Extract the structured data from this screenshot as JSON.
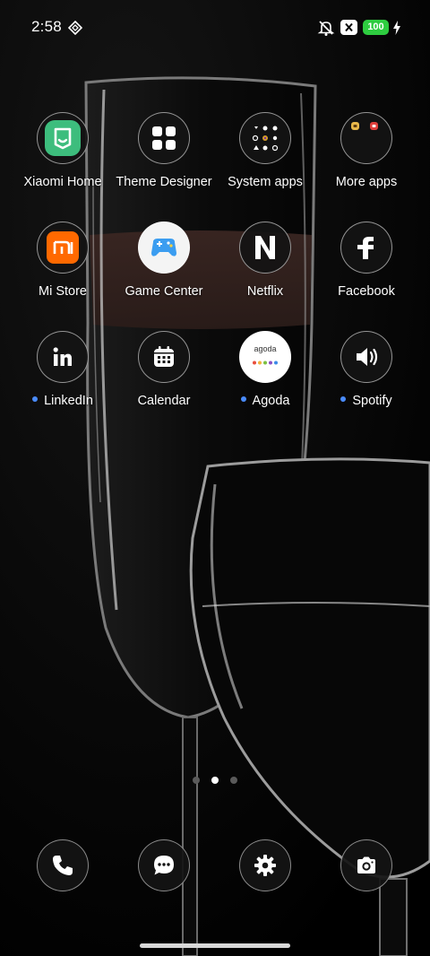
{
  "status_bar": {
    "time": "2:58",
    "battery_level": "100",
    "battery_color": "#2ecc40",
    "icons": [
      "nfc-icon",
      "silent-mode-icon",
      "close-box-icon",
      "battery-icon",
      "charging-bolt-icon"
    ]
  },
  "apps": [
    {
      "label": "Xiaomi Home",
      "icon": "xiaomi-home-icon",
      "new_badge": false
    },
    {
      "label": "Theme Designer",
      "icon": "theme-designer-icon",
      "new_badge": false
    },
    {
      "label": "System apps",
      "icon": "system-apps-folder-icon",
      "new_badge": false
    },
    {
      "label": "More apps",
      "icon": "more-apps-folder-icon",
      "new_badge": false
    },
    {
      "label": "Mi Store",
      "icon": "mi-store-icon",
      "new_badge": false
    },
    {
      "label": "Game Center",
      "icon": "game-center-icon",
      "new_badge": false
    },
    {
      "label": "Netflix",
      "icon": "netflix-icon",
      "new_badge": false
    },
    {
      "label": "Facebook",
      "icon": "facebook-icon",
      "new_badge": false
    },
    {
      "label": "LinkedIn",
      "icon": "linkedin-icon",
      "new_badge": true
    },
    {
      "label": "Calendar",
      "icon": "calendar-icon",
      "new_badge": false
    },
    {
      "label": "Agoda",
      "icon": "agoda-icon",
      "new_badge": true,
      "logo_text": "agoda"
    },
    {
      "label": "Spotify",
      "icon": "spotify-icon",
      "new_badge": true
    }
  ],
  "page_indicator": {
    "pages": 3,
    "current": 2
  },
  "dock": [
    "phone-icon",
    "messages-icon",
    "settings-gear-icon",
    "camera-icon"
  ],
  "colors": {
    "new_badge": "#4a8cff",
    "xiaomi_home": "#3dbd7d",
    "mi_store": "#ff6900"
  }
}
